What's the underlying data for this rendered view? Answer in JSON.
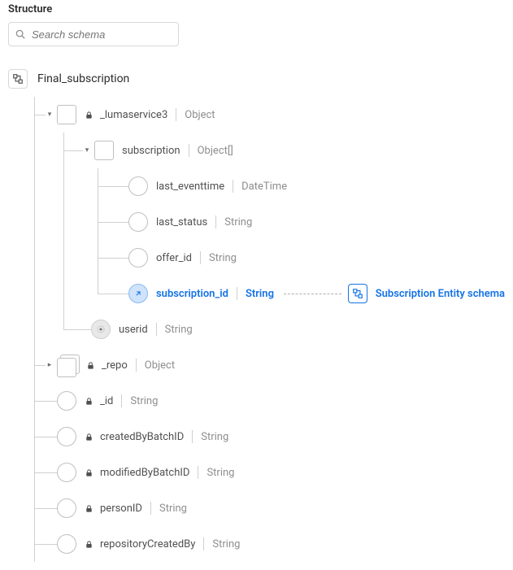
{
  "panel": {
    "title": "Structure"
  },
  "search": {
    "placeholder": "Search schema"
  },
  "root": {
    "name": "Final_subscription"
  },
  "luma": {
    "name": "_lumaservice3",
    "type": "Object",
    "sub": {
      "name": "subscription",
      "type": "Object[]",
      "fields": {
        "last_eventtime": {
          "name": "last_eventtime",
          "type": "DateTime"
        },
        "last_status": {
          "name": "last_status",
          "type": "String"
        },
        "offer_id": {
          "name": "offer_id",
          "type": "String"
        },
        "subscription_id": {
          "name": "subscription_id",
          "type": "String"
        }
      }
    },
    "userid": {
      "name": "userid",
      "type": "String"
    }
  },
  "repo": {
    "name": "_repo",
    "type": "Object"
  },
  "fields": {
    "id": {
      "name": "_id",
      "type": "String"
    },
    "createdByBatchID": {
      "name": "createdByBatchID",
      "type": "String"
    },
    "modifiedByBatchID": {
      "name": "modifiedByBatchID",
      "type": "String"
    },
    "personID": {
      "name": "personID",
      "type": "String"
    },
    "repositoryCreatedBy": {
      "name": "repositoryCreatedBy",
      "type": "String"
    }
  },
  "relationship": {
    "label": "Subscription Entity schema"
  }
}
